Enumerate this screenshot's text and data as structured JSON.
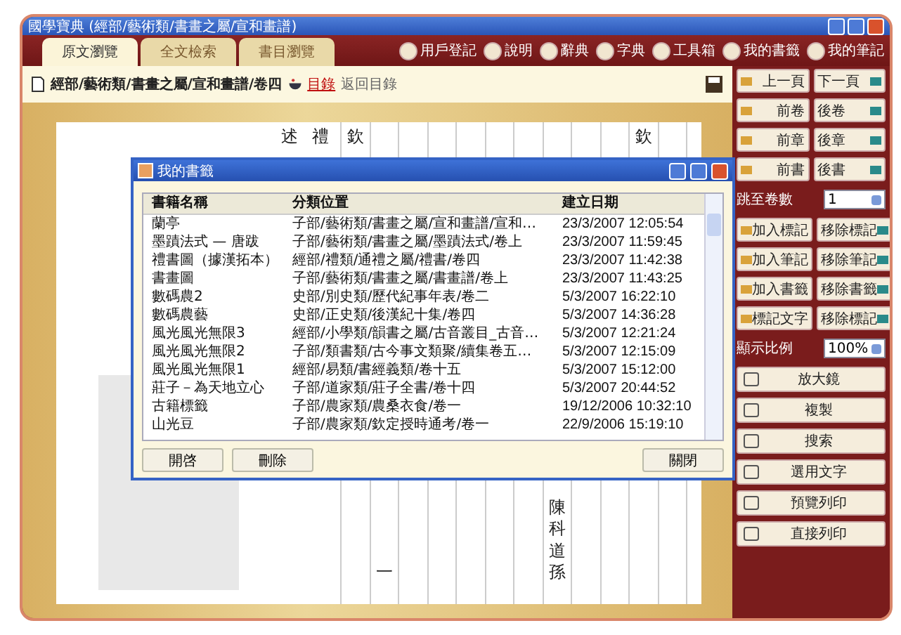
{
  "window": {
    "title": "國學寶典 (經部/藝術類/書畫之屬/宣和畫譜)"
  },
  "tabs": [
    {
      "label": "原文瀏覽",
      "selected": true
    },
    {
      "label": "全文檢索",
      "selected": false
    },
    {
      "label": "書目瀏覽",
      "selected": false
    }
  ],
  "toolbar": [
    {
      "label": "用戶登記"
    },
    {
      "label": "說明"
    },
    {
      "label": "辭典"
    },
    {
      "label": "字典"
    },
    {
      "label": "工具箱"
    },
    {
      "label": "我的書籤"
    },
    {
      "label": "我的筆記"
    }
  ],
  "breadcrumb": {
    "path": "經部/藝術類/書畫之屬/宣和畫譜/卷四",
    "link": "目錄",
    "note": "返回目錄"
  },
  "document": {
    "side_columns": [
      "述",
      "禮"
    ],
    "columns": [
      {
        "top": "欽"
      },
      {
        "bottom": "一"
      },
      {},
      {},
      {},
      {},
      {},
      {
        "bottom": "陳科道孫"
      },
      {},
      {},
      {
        "top": "欽"
      },
      {}
    ]
  },
  "dialog": {
    "title": "我的書籤",
    "columns": [
      "書籍名稱",
      "分類位置",
      "建立日期"
    ],
    "rows": [
      {
        "name": "蘭亭",
        "location": "子部/藝術類/書畫之屬/宣和畫譜/宣和…",
        "date": "23/3/2007 12:05:54",
        "selected": false
      },
      {
        "name": "墨蹟法式 — 唐跋",
        "location": "子部/藝術類/書畫之屬/墨蹟法式/卷上",
        "date": "23/3/2007 11:59:45",
        "selected": false
      },
      {
        "name": "禮書圖（據漢拓本）",
        "location": "經部/禮類/通禮之屬/禮書/卷四",
        "date": "23/3/2007 11:42:38",
        "selected": false
      },
      {
        "name": "書畫圖",
        "location": "子部/藝術類/書畫之屬/書畫譜/卷上",
        "date": "23/3/2007 11:43:25",
        "selected": false
      },
      {
        "name": "數碼農2",
        "location": "史部/別史類/歷代紀事年表/卷二",
        "date": "5/3/2007 16:22:10",
        "selected": false
      },
      {
        "name": "數碼農藝",
        "location": "史部/正史類/後漢紀十集/卷四",
        "date": "5/3/2007 14:36:28",
        "selected": false
      },
      {
        "name": "風光風光無限3",
        "location": "經部/小學類/韻書之屬/古音叢目_古音…",
        "date": "5/3/2007 12:21:24",
        "selected": false
      },
      {
        "name": "風光風光無限2",
        "location": "子部/類書類/古今事文類聚/續集卷五…",
        "date": "5/3/2007 12:15:09",
        "selected": false
      },
      {
        "name": "風光風光無限1",
        "location": "經部/易類/書經義類/卷十五",
        "date": "5/3/2007 15:12:00",
        "selected": false
      },
      {
        "name": "莊子－為天地立心",
        "location": "子部/道家類/莊子全書/卷十四",
        "date": "5/3/2007 20:44:52",
        "selected": false
      },
      {
        "name": "古籍標籤",
        "location": "子部/農家類/農桑衣食/卷一",
        "date": "19/12/2006 10:32:10",
        "selected": false
      },
      {
        "name": "山光豆",
        "location": "子部/農家類/欽定授時通考/卷一",
        "date": "22/9/2006 15:19:10",
        "selected": false
      }
    ],
    "left_buttons": [
      "開啓",
      "刪除"
    ],
    "right_buttons": [
      "關閉"
    ]
  },
  "side_panel": [
    {
      "kind": "pair",
      "buttons": [
        "上一頁",
        "下一頁"
      ]
    },
    {
      "kind": "pair",
      "buttons": [
        "前卷",
        "後卷"
      ]
    },
    {
      "kind": "pair",
      "buttons": [
        "前章",
        "後章"
      ]
    },
    {
      "kind": "pair",
      "buttons": [
        "前書",
        "後書"
      ]
    },
    {
      "kind": "select",
      "label": "跳至卷數",
      "value": "1"
    },
    {
      "kind": "pair",
      "buttons": [
        "加入標記",
        "移除標記"
      ]
    },
    {
      "kind": "pair",
      "buttons": [
        "加入筆記",
        "移除筆記"
      ]
    },
    {
      "kind": "pair",
      "buttons": [
        "加入書籤",
        "移除書籤"
      ]
    },
    {
      "kind": "pair",
      "buttons": [
        "標記文字",
        "移除標記"
      ]
    },
    {
      "kind": "select",
      "label": "顯示比例",
      "value": "100%"
    },
    {
      "kind": "wide",
      "label": "放大鏡"
    },
    {
      "kind": "wide",
      "label": "複製"
    },
    {
      "kind": "wide",
      "label": "搜索"
    },
    {
      "kind": "wide",
      "label": "選用文字"
    },
    {
      "kind": "wide",
      "label": "預覽列印"
    },
    {
      "kind": "wide",
      "label": "直接列印"
    }
  ]
}
